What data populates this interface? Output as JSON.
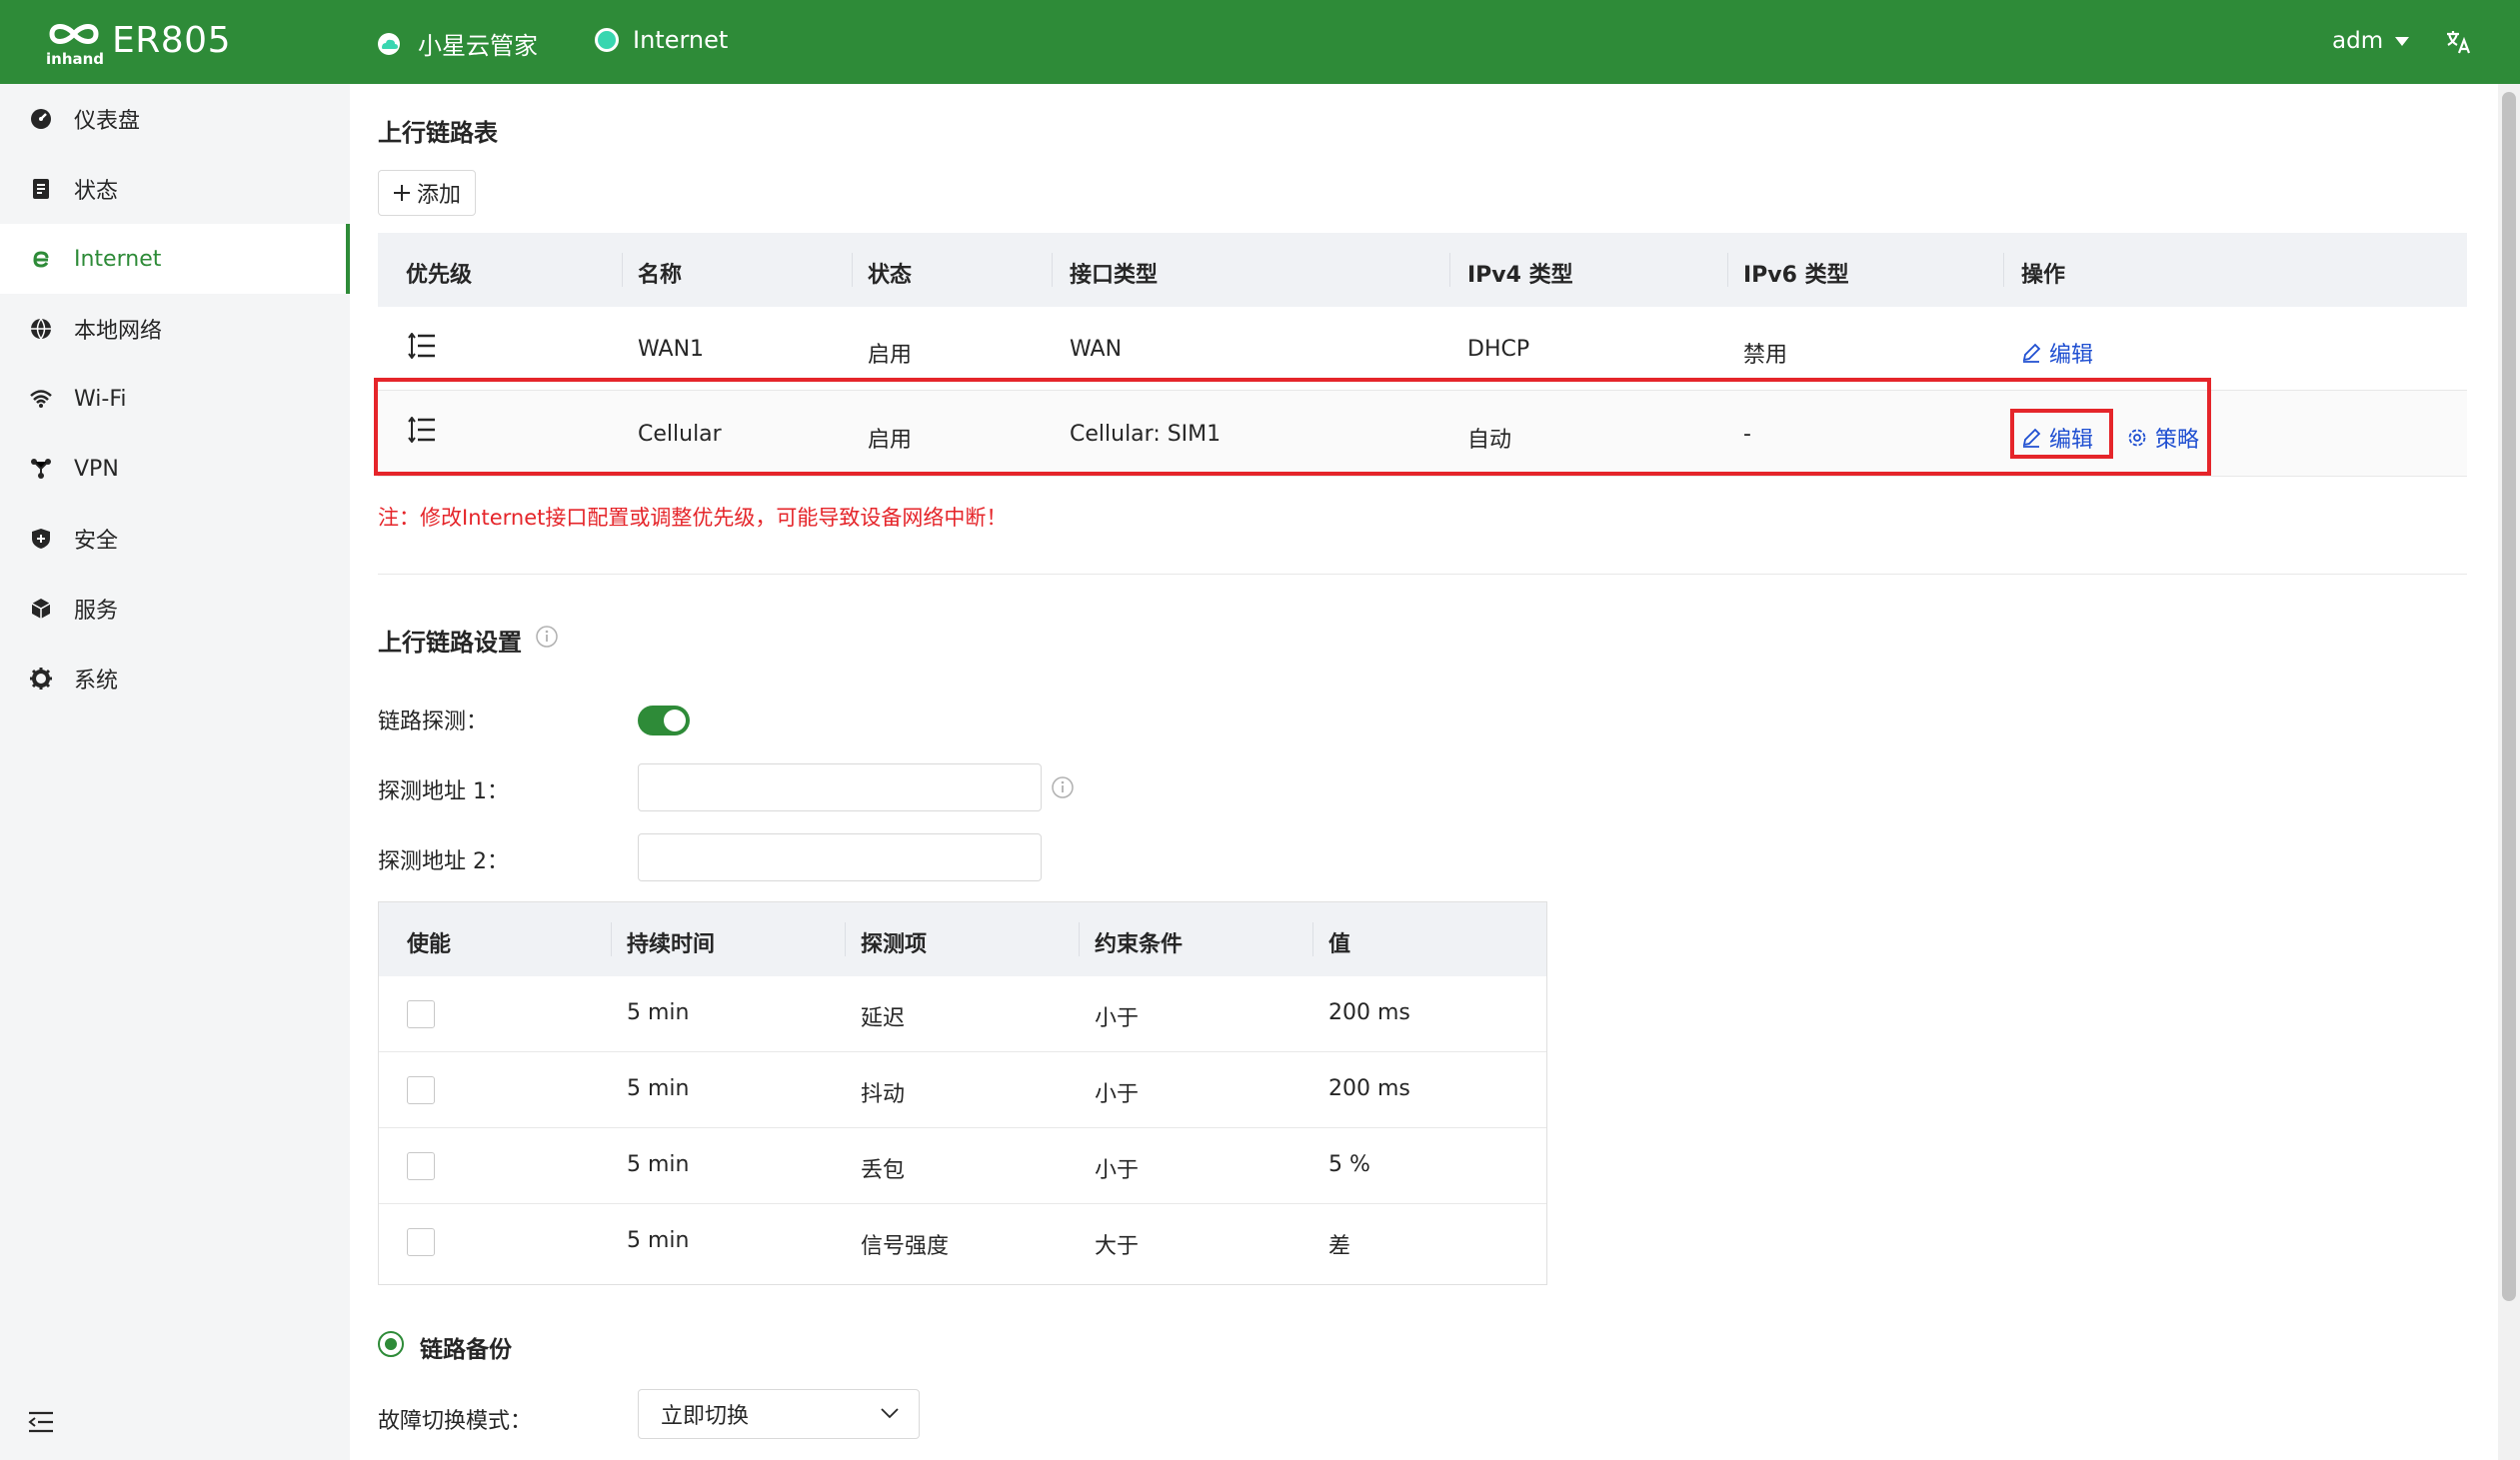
{
  "header": {
    "product": "ER805",
    "nav": [
      {
        "label": "小星云管家"
      },
      {
        "label": "Internet"
      }
    ],
    "user": "adm"
  },
  "sidebar": {
    "items": [
      {
        "label": "仪表盘",
        "icon": "dashboard-icon"
      },
      {
        "label": "状态",
        "icon": "status-icon"
      },
      {
        "label": "Internet",
        "icon": "internet-icon",
        "active": true
      },
      {
        "label": "本地网络",
        "icon": "globe-icon"
      },
      {
        "label": "Wi-Fi",
        "icon": "wifi-icon"
      },
      {
        "label": "VPN",
        "icon": "vpn-icon"
      },
      {
        "label": "安全",
        "icon": "shield-icon"
      },
      {
        "label": "服务",
        "icon": "cube-icon"
      },
      {
        "label": "系统",
        "icon": "gear-icon"
      }
    ]
  },
  "uplink_table": {
    "title": "上行链路表",
    "add_label": "添加",
    "headers": [
      "优先级",
      "名称",
      "状态",
      "接口类型",
      "IPv4 类型",
      "IPv6 类型",
      "操作"
    ],
    "rows": [
      {
        "name": "WAN1",
        "status": "启用",
        "iface": "WAN",
        "ipv4": "DHCP",
        "ipv6": "禁用",
        "edit": "编辑"
      },
      {
        "name": "Cellular",
        "status": "启用",
        "iface": "Cellular: SIM1",
        "ipv4": "自动",
        "ipv6": "-",
        "edit": "编辑",
        "policy": "策略"
      }
    ],
    "note": "注：修改Internet接口配置或调整优先级，可能导致设备网络中断！"
  },
  "uplink_settings": {
    "title": "上行链路设置",
    "probe_label": "链路探测：",
    "probe_enabled": true,
    "addr1_label": "探测地址 1：",
    "addr1_value": "",
    "addr2_label": "探测地址 2：",
    "addr2_value": "",
    "probe_table": {
      "headers": [
        "使能",
        "持续时间",
        "探测项",
        "约束条件",
        "值"
      ],
      "rows": [
        {
          "enabled": false,
          "duration": "5 min",
          "item": "延迟",
          "condition": "小于",
          "value": "200 ms"
        },
        {
          "enabled": false,
          "duration": "5 min",
          "item": "抖动",
          "condition": "小于",
          "value": "200 ms"
        },
        {
          "enabled": false,
          "duration": "5 min",
          "item": "丢包",
          "condition": "小于",
          "value": "5 %"
        },
        {
          "enabled": false,
          "duration": "5 min",
          "item": "信号强度",
          "condition": "大于",
          "value": "差"
        }
      ]
    },
    "backup_label": "链路备份",
    "failover_label": "故障切换模式：",
    "failover_value": "立即切换"
  },
  "colors": {
    "brand": "#2e8b38",
    "link": "#1f4fd1",
    "highlight": "#e5252a"
  }
}
